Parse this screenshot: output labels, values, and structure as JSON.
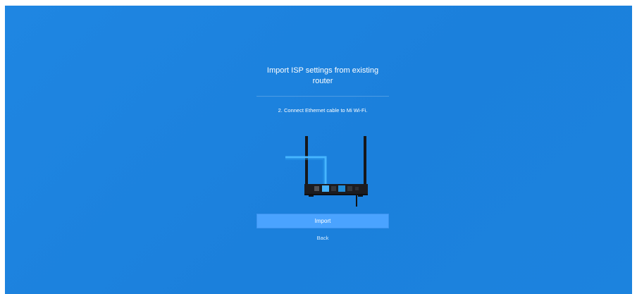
{
  "page": {
    "title": "Import ISP settings from existing router",
    "step_text": "2. Connect Ethernet cable to Mi Wi-Fi.",
    "import_label": "Import",
    "back_label": "Back"
  },
  "illustration": {
    "name": "router-with-ethernet-cable-illustration"
  },
  "colors": {
    "background": "#1f86e2",
    "button": "#4aa3ff",
    "router": "#1f1f22",
    "cable": "#42b4ff"
  }
}
